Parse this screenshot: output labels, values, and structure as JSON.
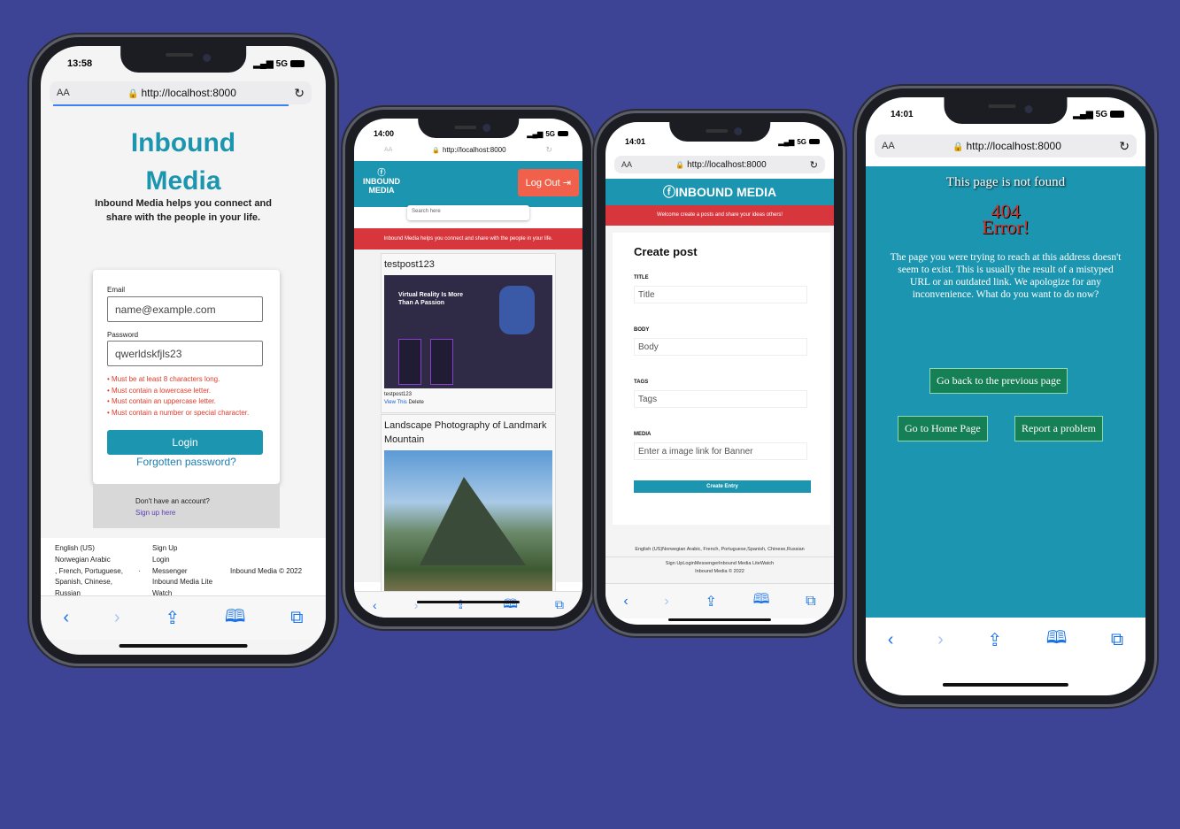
{
  "nav_icons": [
    "chevron-left",
    "chevron-right",
    "share",
    "book",
    "tabs"
  ],
  "colors": {
    "background": "#3d4496",
    "brand_teal": "#1c96b0",
    "brand_red": "#d8363d",
    "logout_orange": "#f0604a"
  },
  "phone1": {
    "time": "13:58",
    "signal": "5G",
    "url": "http://localhost:8000",
    "aa": "AA",
    "title_line1": "Inbound",
    "title_line2": "Media",
    "tagline": "Inbound Media helps you connect and share with the people in your life.",
    "email_label": "Email",
    "email_placeholder": "name@example.com",
    "password_label": "Password",
    "password_value": "qwerldskfjls23",
    "errors": [
      "Must be at least 8 characters long.",
      "Must contain a lowercase letter.",
      "Must contain an uppercase letter.",
      "Must contain a number or special character."
    ],
    "login_button": "Login",
    "forgot_link": "Forgotten password?",
    "no_account": "Don't have an account?",
    "signup_link": "Sign up here",
    "footer_languages": "English (US)\nNorwegian Arabic\n, French, Portuguese,\nSpanish, Chinese,\nRussian",
    "footer_dot": "·",
    "footer_links": "Sign Up\nLogin\nMessenger\nInbound Media Lite\nWatch",
    "footer_copy": "Inbound Media © 2022"
  },
  "phone2": {
    "time": "14:00",
    "signal": "5G",
    "url": "http://localhost:8000",
    "aa": "AA",
    "logo": "INBOUND\nMEDIA",
    "logout": "Log Out",
    "search_placeholder": "Search here",
    "banner": "Inbound Media helps you connect and share with the people in your life.",
    "post1_title": "testpost123",
    "post1_img_text": "Virtual Reality Is More Than A Passion",
    "post1_meta": "testpost123",
    "post1_view": "View This",
    "post1_delete": "Delete",
    "post2_title": "Landscape Photography of Landmark Mountain"
  },
  "phone3": {
    "time": "14:01",
    "signal": "5G",
    "url": "http://localhost:8000",
    "aa": "AA",
    "header": "INBOUND MEDIA",
    "banner": "Welcome create a posts and share your ideas others!",
    "heading": "Create post",
    "fields": [
      {
        "label": "TITLE",
        "placeholder": "Title"
      },
      {
        "label": "BODY",
        "placeholder": "Body"
      },
      {
        "label": "TAGS",
        "placeholder": "Tags"
      },
      {
        "label": "MEDIA",
        "placeholder": "Enter a image link for Banner"
      }
    ],
    "submit": "Create Entry",
    "footer_languages": "English (US)Norwegian Arabic, French, Portuguese,Spanish, Chinese,Russian",
    "footer_links": "Sign UpLoginMessengerInbound Media LiteWatch",
    "footer_copy": "Inbound Media © 2022"
  },
  "phone4": {
    "time": "14:01",
    "signal": "5G",
    "url": "http://localhost:8000",
    "aa": "AA",
    "title": "This page is not found",
    "code": "404",
    "error": "Error!",
    "message": "The page you were trying to reach at this address doesn't seem to exist. This is usually the result of a mistyped URL or an outdated link. We apologize for any inconvenience. What do you want to do now?",
    "back_button": "Go back to the previous page",
    "home_button": "Go to Home Page",
    "report_button": "Report a problem"
  }
}
